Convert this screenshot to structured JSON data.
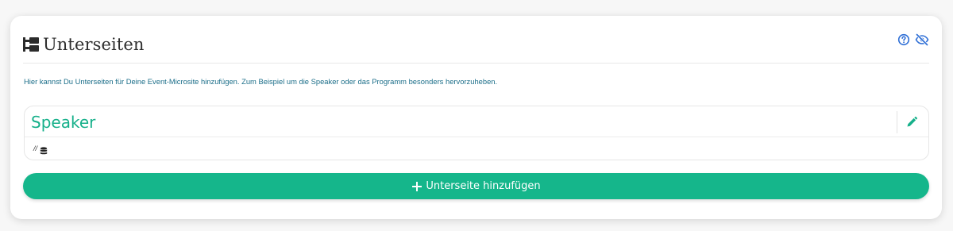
{
  "section": {
    "title": "Unterseiten",
    "title_icon": "sitemap-icon",
    "help_icon": "question-circle-icon",
    "visibility_icon": "eye-slash-icon",
    "hint": "Hier kannst Du Unterseiten für Deine Event-Microsite hinzufügen. Zum Beispiel um die Speaker oder das Programm besonders hervorzuheben."
  },
  "subpages": [
    {
      "title": "Speaker",
      "path": "//",
      "path_icon": "database-icon",
      "edit_icon": "pencil-icon"
    }
  ],
  "add_button": {
    "label": "Unterseite hinzufügen",
    "icon": "plus-icon"
  },
  "colors": {
    "accent": "#15b68b",
    "title_green": "#16b08a",
    "hint_text": "#1d6f8a",
    "icon_blue": "#2f6fd6"
  }
}
